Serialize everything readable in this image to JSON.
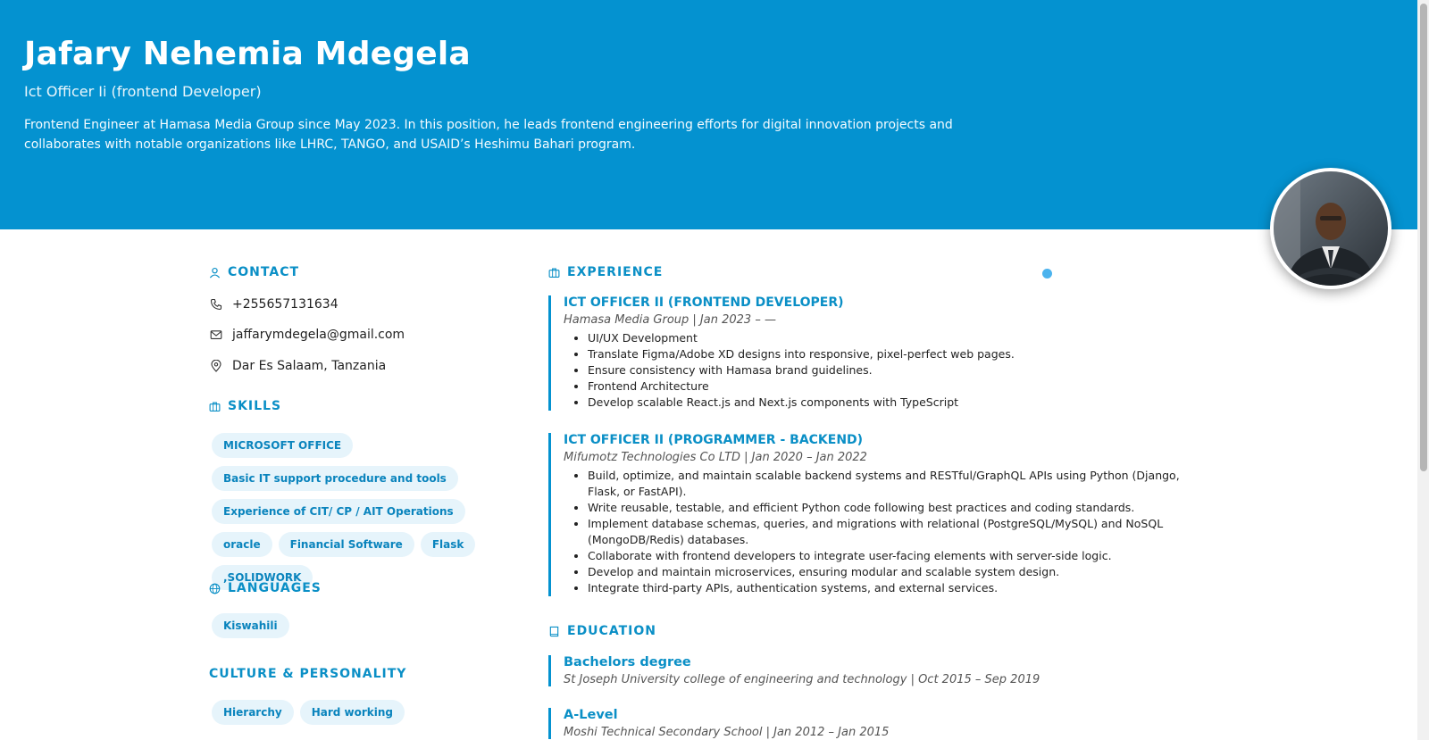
{
  "header": {
    "name": "Jafary Nehemia Mdegela",
    "title": "Ict Officer Ii (frontend Developer)",
    "bio": "Frontend Engineer at Hamasa Media Group since May 2023. In this position, he leads frontend engineering efforts for digital innovation projects and collaborates with notable organizations like LHRC, TANGO, and USAID’s Heshimu Bahari program.",
    "accent_color": "#0492d0"
  },
  "contact": {
    "heading": "CONTACT",
    "phone": "+255657131634",
    "email": "jaffarymdegela@gmail.com",
    "location": "Dar Es Salaam, Tanzania"
  },
  "skills": {
    "heading": "SKILLS",
    "items": [
      "MICROSOFT OFFICE",
      "Basic IT support procedure and tools",
      "Experience of CIT/ CP / AIT Operations",
      "oracle",
      "Financial Software",
      "Flask",
      ",SOLIDWORK"
    ]
  },
  "languages": {
    "heading": "LANGUAGES",
    "items": [
      "Kiswahili"
    ]
  },
  "culture": {
    "heading": "CULTURE & PERSONALITY",
    "items": [
      "Hierarchy",
      "Hard working"
    ]
  },
  "experience": {
    "heading": "EXPERIENCE",
    "jobs": [
      {
        "role": "ICT OFFICER II (FRONTEND DEVELOPER)",
        "meta": "Hamasa Media Group | Jan 2023 – —",
        "bullets": [
          "UI/UX Development",
          "Translate Figma/Adobe XD designs into responsive, pixel-perfect web pages.",
          "Ensure consistency with Hamasa brand guidelines.",
          "Frontend Architecture",
          "Develop scalable React.js and Next.js components with TypeScript"
        ]
      },
      {
        "role": "ICT OFFICER II (PROGRAMMER - BACKEND)",
        "meta": "Mifumotz Technologies Co LTD | Jan 2020 – Jan 2022",
        "bullets": [
          "Build, optimize, and maintain scalable backend systems and RESTful/GraphQL APIs using Python (Django, Flask, or FastAPI).",
          "Write reusable, testable, and efficient Python code following best practices and coding standards.",
          "Implement database schemas, queries, and migrations with relational (PostgreSQL/MySQL) and NoSQL (MongoDB/Redis) databases.",
          "Collaborate with frontend developers to integrate user-facing elements with server-side logic.",
          "Develop and maintain microservices, ensuring modular and scalable system design.",
          "Integrate third-party APIs, authentication systems, and external services."
        ]
      }
    ]
  },
  "education": {
    "heading": "EDUCATION",
    "items": [
      {
        "title": "Bachelors degree",
        "meta": "St Joseph University college of engineering and technology | Oct 2015 – Sep 2019"
      },
      {
        "title": "A-Level",
        "meta": "Moshi Technical Secondary School | Jan 2012 – Jan 2015"
      }
    ]
  }
}
